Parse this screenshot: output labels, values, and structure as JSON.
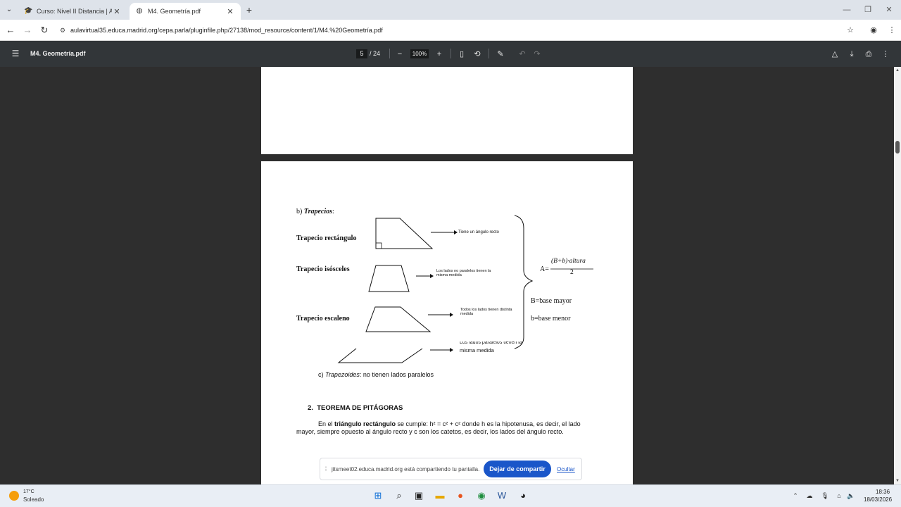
{
  "browser": {
    "tabs": [
      {
        "title": "Curso: Nivel II Distancia | AulaV",
        "icon": "graduation-cap-icon"
      },
      {
        "title": "M4. Geometría.pdf",
        "icon": "globe-icon"
      }
    ],
    "url": "aulavirtual35.educa.madrid.org/cepa.parla/pluginfile.php/27138/mod_resource/content/1/M4.%20Geometría.pdf"
  },
  "pdf_toolbar": {
    "filename": "M4. Geometría.pdf",
    "current_page": "5",
    "total_pages": "/ 24",
    "zoom": "100%"
  },
  "document": {
    "section_b_prefix": "b)",
    "section_b_title": "Trapecios",
    "section_b_colon": ":",
    "trapezoids": [
      {
        "name": "Trapecio rectángulo",
        "note": "Tiene un ángulo recto"
      },
      {
        "name": "Trapecio isósceles",
        "note_line1": "Los lados no paralelos tienen la",
        "note_line2": "misma medida"
      },
      {
        "name": "Trapecio escaleno",
        "note_line1": "Todos los lados tienen distinta",
        "note_line2": "medida"
      }
    ],
    "partial_note_line1": "Los lados paralelos tienen la",
    "partial_note_line2": "misma medida",
    "formula_prefix": "A=",
    "formula_numerator": "(B+b)·altura",
    "formula_denominator": "2",
    "base_major": "B=base mayor",
    "base_minor": "b=base menor",
    "section_c_prefix": "c)",
    "section_c_title": "Trapezoides",
    "section_c_rest": ": no tienen lados paralelos",
    "heading_number": "2.",
    "heading_title": "TEOREMA DE PITÁGORAS",
    "para_line1_a": "En el ",
    "para_line1_bold": "triángulo rectángulo",
    "para_line1_b": " se cumple: h² = c² + c² donde h es la hipotenusa, es decir, el lado",
    "para_line2": "mayor, siempre opuesto al ángulo recto y c son los catetos, es decir, los lados del ángulo recto."
  },
  "share_banner": {
    "message": "jitsmeet02.educa.madrid.org está compartiendo tu pantalla.",
    "stop_label": "Dejar de compartir",
    "hide_label": "Ocultar"
  },
  "taskbar": {
    "temperature": "17°C",
    "weather": "Soleado",
    "time": "18:36",
    "date": "18/03/2026"
  }
}
